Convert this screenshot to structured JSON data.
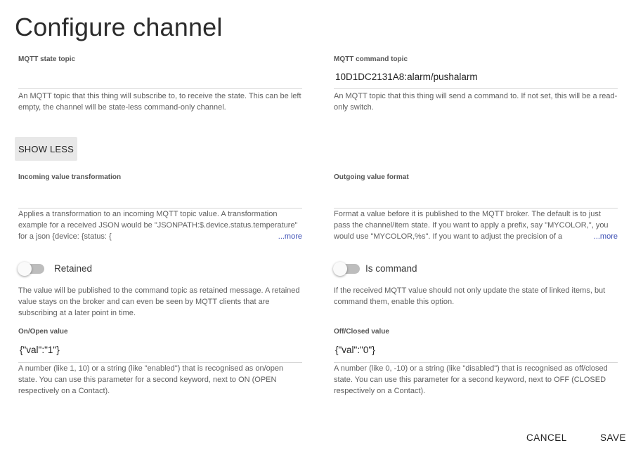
{
  "dialog": {
    "title": "Configure channel"
  },
  "state_topic": {
    "label": "MQTT state topic",
    "value": "",
    "help": "An MQTT topic that this thing will subscribe to, to receive the state. This can be left empty, the channel will be state-less command-only channel."
  },
  "command_topic": {
    "label": "MQTT command topic",
    "value": "10D1DC2131A8:alarm/pushalarm",
    "help": "An MQTT topic that this thing will send a command to. If not set, this will be a read-only switch."
  },
  "show_less_label": "SHOW LESS",
  "incoming_transform": {
    "label": "Incoming value transformation",
    "value": "",
    "help": "Applies a transformation to an incoming MQTT topic value. A transformation example for a received JSON would be \"JSONPATH:$.device.status.temperature\" for a json {device: {status: {",
    "more": "...more"
  },
  "outgoing_format": {
    "label": "Outgoing value format",
    "value": "",
    "help": "Format a value before it is published to the MQTT broker. The default is to just pass the channel/item state. If you want to apply a prefix, say \"MYCOLOR,\", you would use \"MYCOLOR,%s\". If you want to adjust the precision of a",
    "more": "...more"
  },
  "retained": {
    "label": "Retained",
    "checked": false,
    "help": "The value will be published to the command topic as retained message. A retained value stays on the broker and can even be seen by MQTT clients that are subscribing at a later point in time."
  },
  "is_command": {
    "label": "Is command",
    "checked": false,
    "help": "If the received MQTT value should not only update the state of linked items, but command them, enable this option."
  },
  "on_value": {
    "label": "On/Open value",
    "value": "{\"val\":\"1\"}",
    "help": "A number (like 1, 10) or a string (like \"enabled\") that is recognised as on/open state. You can use this parameter for a second keyword, next to ON (OPEN respectively on a Contact)."
  },
  "off_value": {
    "label": "Off/Closed value",
    "value": "{\"val\":\"0\"}",
    "help": "A number (like 0, -10) or a string (like \"disabled\") that is recognised as off/closed state. You can use this parameter for a second keyword, next to OFF (CLOSED respectively on a Contact)."
  },
  "actions": {
    "cancel": "CANCEL",
    "save": "SAVE"
  }
}
